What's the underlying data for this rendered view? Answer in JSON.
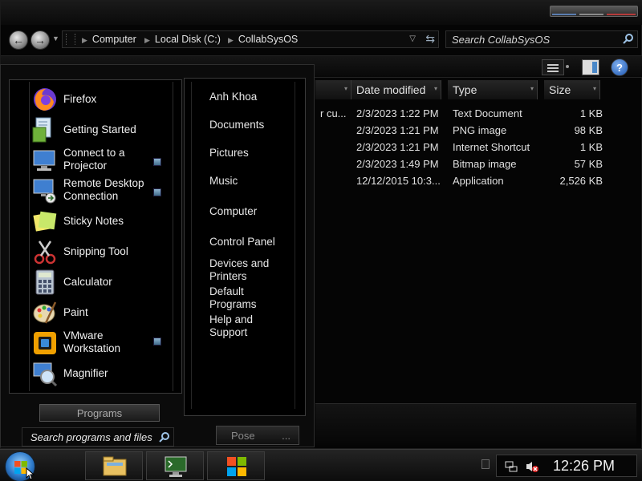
{
  "address": {
    "crumbs": [
      "Computer",
      "Local Disk (C:)",
      "CollabSysOS"
    ]
  },
  "search": {
    "placeholder": "Search CollabSysOS"
  },
  "columns": {
    "date_modified": "Date modified",
    "type": "Type",
    "size": "Size"
  },
  "files": [
    {
      "name": "r cu...",
      "date": "2/3/2023 1:22 PM",
      "type": "Text Document",
      "size": "1 KB"
    },
    {
      "name": "",
      "date": "2/3/2023 1:21 PM",
      "type": "PNG image",
      "size": "98 KB"
    },
    {
      "name": "",
      "date": "2/3/2023 1:21 PM",
      "type": "Internet Shortcut",
      "size": "1 KB"
    },
    {
      "name": "",
      "date": "2/3/2023 1:49 PM",
      "type": "Bitmap image",
      "size": "57 KB"
    },
    {
      "name": "",
      "date": "12/12/2015 10:3...",
      "type": "Application",
      "size": "2,526 KB"
    }
  ],
  "start_menu": {
    "programs": [
      {
        "label": "Firefox",
        "icon": "firefox-icon",
        "has_jumplist": true
      },
      {
        "label": "Getting Started",
        "icon": "getting-started-icon",
        "has_jumplist": true
      },
      {
        "label_lines": [
          "Connect to a",
          "Projector"
        ],
        "icon": "projector-icon",
        "has_jumplist": false
      },
      {
        "label_lines": [
          "Remote Desktop",
          "Connection"
        ],
        "icon": "remote-desktop-icon",
        "has_jumplist": false
      },
      {
        "label": "Sticky Notes",
        "icon": "sticky-notes-icon",
        "has_jumplist": false
      },
      {
        "label": "Snipping Tool",
        "icon": "snipping-tool-icon",
        "has_jumplist": false
      },
      {
        "label": "Calculator",
        "icon": "calculator-icon",
        "has_jumplist": false
      },
      {
        "label": "Paint",
        "icon": "paint-icon",
        "has_jumplist": false
      },
      {
        "label_lines": [
          "VMware",
          "Workstation"
        ],
        "icon": "vmware-icon",
        "has_jumplist": true
      },
      {
        "label": "Magnifier",
        "icon": "magnifier-icon",
        "has_jumplist": false
      }
    ],
    "all_programs_label": "Programs",
    "search_placeholder": "Search programs and files",
    "places": [
      {
        "label": "Anh Khoa"
      },
      {
        "label": "Documents"
      },
      {
        "label": "Pictures"
      },
      {
        "label": "Music"
      },
      {
        "label": "Computer"
      },
      {
        "label": "Control Panel"
      },
      {
        "label_lines": [
          "Devices and",
          "Printers"
        ]
      },
      {
        "label_lines": [
          "Default",
          "Programs"
        ]
      },
      {
        "label_lines": [
          "Help and",
          "Support"
        ]
      }
    ],
    "power_label": "Pose",
    "power_arrow": "..."
  },
  "taskbar": {
    "pinned": [
      "file-explorer-icon",
      "terminal-icon",
      "windows-logo-icon"
    ],
    "clock": "12:26 PM"
  },
  "colors": {
    "background": "#000000",
    "text": "#e6e6e6",
    "accent": "#2c78c8"
  }
}
